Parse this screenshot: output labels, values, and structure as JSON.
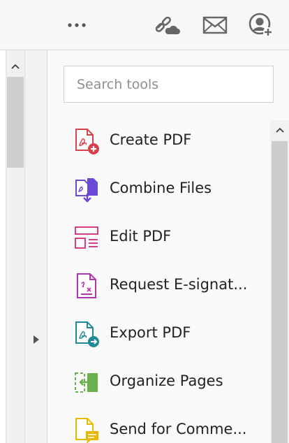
{
  "toolbar": {
    "icons": [
      "more-options-icon",
      "share-link-icon",
      "mail-icon",
      "account-icon"
    ]
  },
  "search": {
    "placeholder": "Search tools"
  },
  "tools": [
    {
      "label": "Create PDF",
      "icon": "create-pdf-icon",
      "color": "#d9414a"
    },
    {
      "label": "Combine Files",
      "icon": "combine-files-icon",
      "color": "#6c48d6"
    },
    {
      "label": "Edit PDF",
      "icon": "edit-pdf-icon",
      "color": "#d83f87"
    },
    {
      "label": "Request E-signat...",
      "icon": "request-esign-icon",
      "color": "#b535b0"
    },
    {
      "label": "Export PDF",
      "icon": "export-pdf-icon",
      "color": "#1f8a96"
    },
    {
      "label": "Organize Pages",
      "icon": "organize-pages-icon",
      "color": "#6ab04c"
    },
    {
      "label": "Send for Comme...",
      "icon": "send-for-comment-icon",
      "color": "#e6b800"
    }
  ]
}
